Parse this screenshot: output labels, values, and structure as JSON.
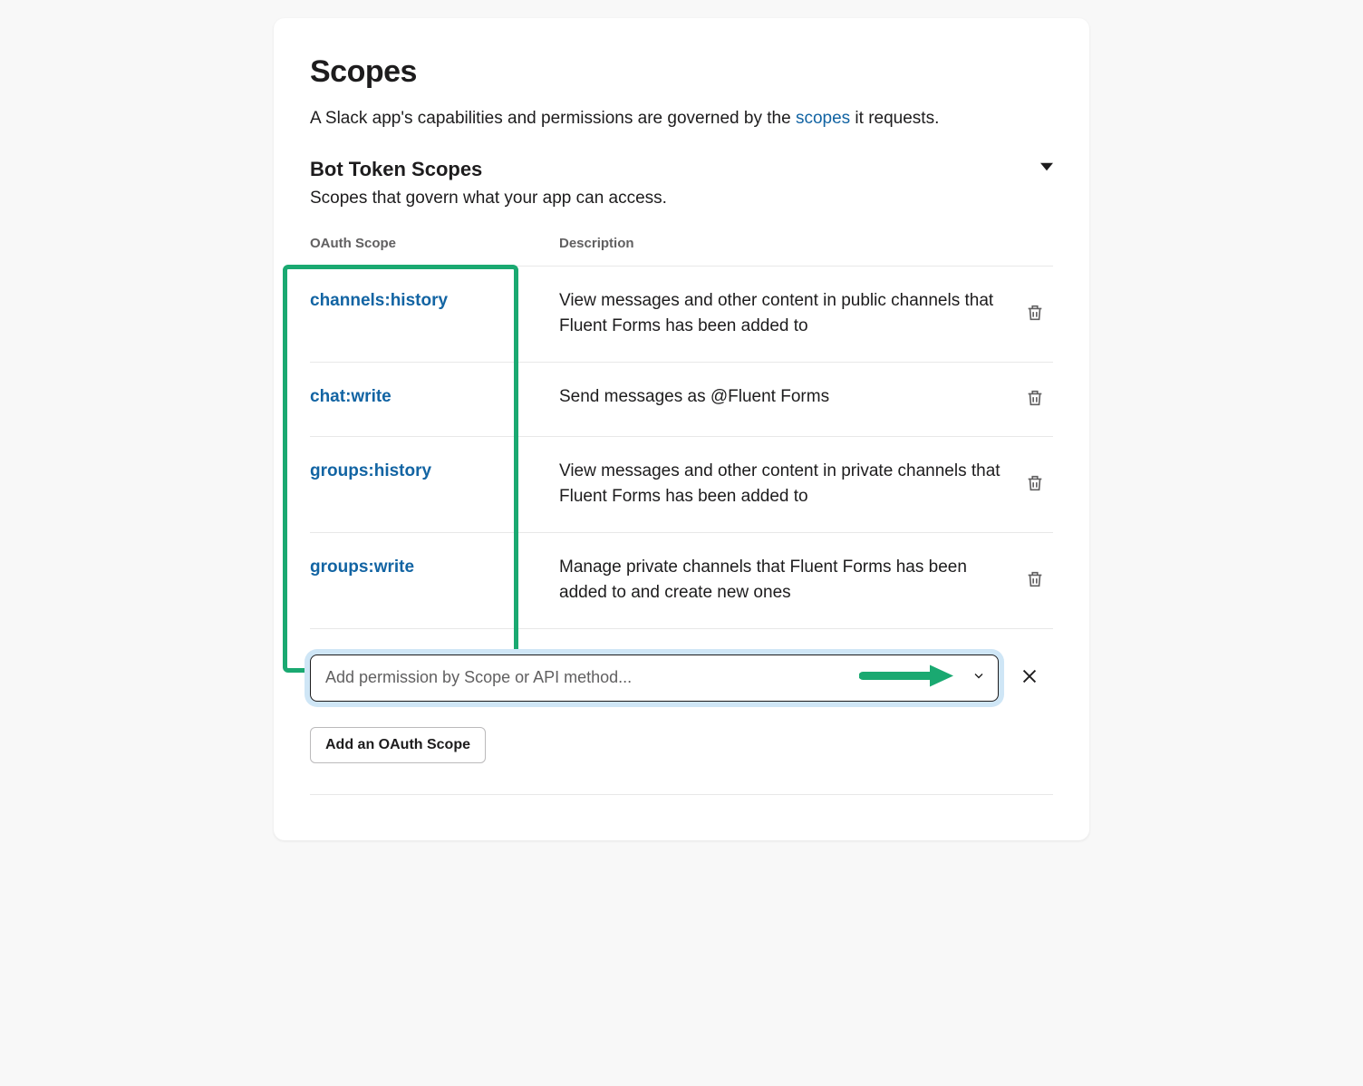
{
  "title": "Scopes",
  "intro_pre": "A Slack app's capabilities and permissions are governed by the ",
  "intro_link": "scopes",
  "intro_post": " it requests.",
  "section": {
    "title": "Bot Token Scopes",
    "subtitle": "Scopes that govern what your app can access."
  },
  "columns": {
    "scope": "OAuth Scope",
    "description": "Description"
  },
  "scopes": [
    {
      "name": "channels:history",
      "description": "View messages and other content in public channels that Fluent Forms has been added to"
    },
    {
      "name": "chat:write",
      "description": "Send messages as @Fluent Forms"
    },
    {
      "name": "groups:history",
      "description": "View messages and other content in private channels that Fluent Forms has been added to"
    },
    {
      "name": "groups:write",
      "description": "Manage private channels that Fluent Forms has been added to and create new ones"
    }
  ],
  "combo_placeholder": "Add permission by Scope or API method...",
  "add_button": "Add an OAuth Scope",
  "colors": {
    "link": "#1264a3",
    "highlight": "#1aa971"
  }
}
